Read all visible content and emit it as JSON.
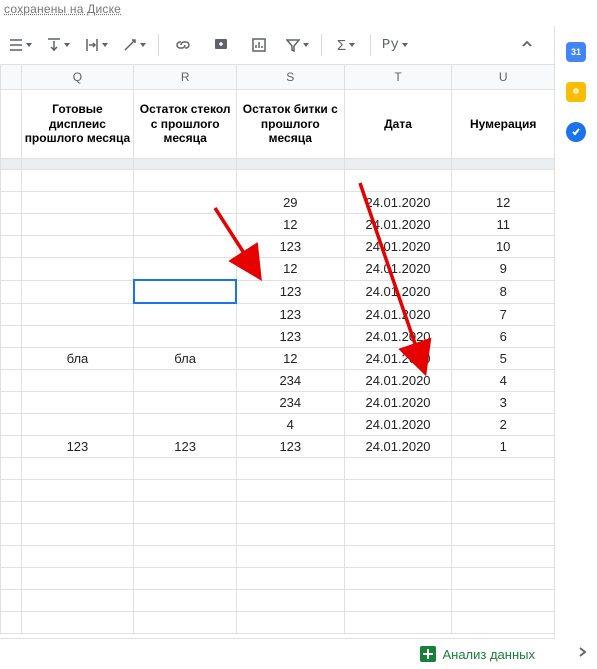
{
  "status_text": "сохранены на Диске",
  "toolbar": {
    "py_label": "Py"
  },
  "sidepanel": {
    "calendar_day": "31"
  },
  "columns": [
    "Q",
    "R",
    "S",
    "T",
    "U"
  ],
  "headers": {
    "Q": "Готовые дисплеис прошлого месяца",
    "R": "Остаток стекол с прошлого месяца",
    "S": "Остаток битки с прошлого месяца",
    "T": "Дата",
    "U": "Нумерация"
  },
  "rows": [
    {
      "Q": "",
      "R": "",
      "S": "",
      "T": "",
      "U": ""
    },
    {
      "Q": "",
      "R": "",
      "S": "29",
      "T": "24.01.2020",
      "U": "12"
    },
    {
      "Q": "",
      "R": "",
      "S": "12",
      "T": "24.01.2020",
      "U": "11"
    },
    {
      "Q": "",
      "R": "",
      "S": "123",
      "T": "24.01.2020",
      "U": "10"
    },
    {
      "Q": "",
      "R": "",
      "S": "12",
      "T": "24.01.2020",
      "U": "9"
    },
    {
      "Q": "",
      "R": "",
      "S": "123",
      "T": "24.01.2020",
      "U": "8",
      "selR": true
    },
    {
      "Q": "",
      "R": "",
      "S": "123",
      "T": "24.01.2020",
      "U": "7"
    },
    {
      "Q": "",
      "R": "",
      "S": "123",
      "T": "24.01.2020",
      "U": "6"
    },
    {
      "Q": "бла",
      "R": "бла",
      "S": "12",
      "T": "24.01.2020",
      "U": "5"
    },
    {
      "Q": "",
      "R": "",
      "S": "234",
      "T": "24.01.2020",
      "U": "4"
    },
    {
      "Q": "",
      "R": "",
      "S": "234",
      "T": "24.01.2020",
      "U": "3"
    },
    {
      "Q": "",
      "R": "",
      "S": "4",
      "T": "24.01.2020",
      "U": "2"
    },
    {
      "Q": "123",
      "R": "123",
      "S": "123",
      "T": "24.01.2020",
      "U": "1"
    }
  ],
  "footer": {
    "explore_label": "Анализ данных"
  }
}
